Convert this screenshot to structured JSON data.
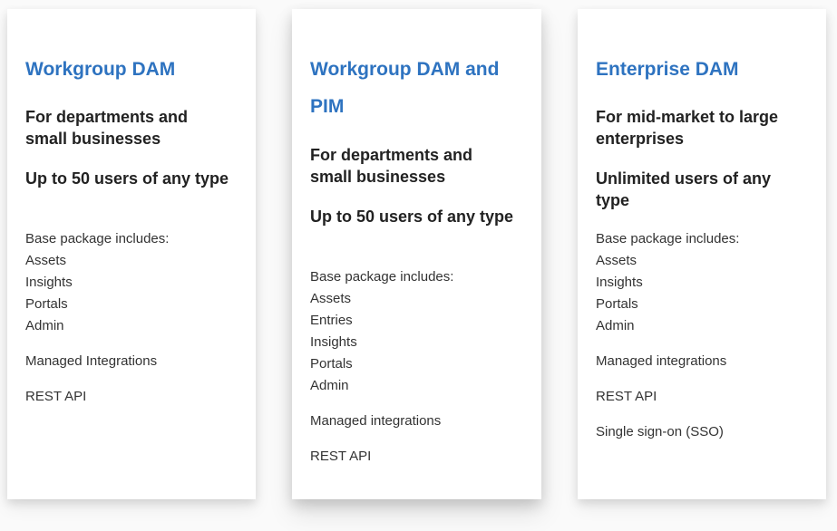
{
  "plans": [
    {
      "title": "Workgroup DAM",
      "subtitle": "For departments and small businesses",
      "users": "Up to 50 users of any type",
      "base_label": "Base package includes:",
      "base_items": [
        "Assets",
        "Insights",
        "Portals",
        "Admin"
      ],
      "extras": [
        "Managed Integrations",
        "REST API"
      ]
    },
    {
      "title": "Workgroup DAM and PIM",
      "subtitle": "For departments and small businesses",
      "users": "Up to 50 users of any type",
      "base_label": "Base package includes:",
      "base_items": [
        "Assets",
        "Entries",
        "Insights",
        "Portals",
        "Admin"
      ],
      "extras": [
        "Managed integrations",
        "REST API"
      ]
    },
    {
      "title": "Enterprise DAM",
      "subtitle": "For mid-market to large enterprises",
      "users": "Unlimited users of any type",
      "base_label": "Base package includes:",
      "base_items": [
        "Assets",
        "Insights",
        "Portals",
        "Admin"
      ],
      "extras": [
        "Managed integrations",
        "REST API",
        "Single sign-on (SSO)"
      ]
    }
  ]
}
